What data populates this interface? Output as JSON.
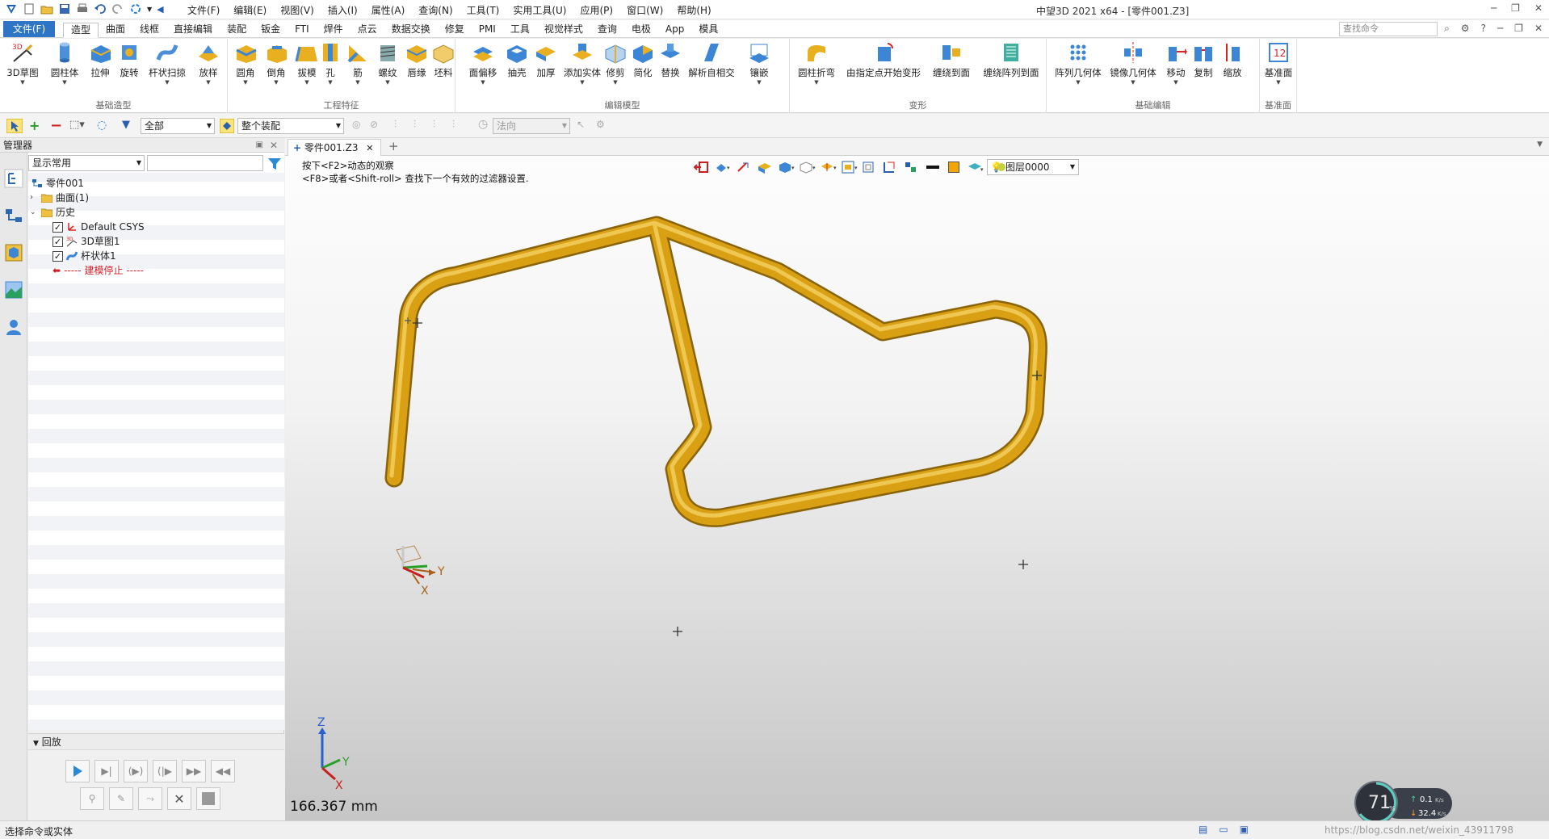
{
  "titlebar": {
    "menus": [
      "文件(F)",
      "编辑(E)",
      "视图(V)",
      "插入(I)",
      "属性(A)",
      "查询(N)",
      "工具(T)",
      "实用工具(U)",
      "应用(P)",
      "窗口(W)",
      "帮助(H)"
    ],
    "window_title": "中望3D 2021 x64 - [零件001.Z3]"
  },
  "tabs": {
    "file": "文件(F)",
    "items": [
      "造型",
      "曲面",
      "线框",
      "直接编辑",
      "装配",
      "钣金",
      "FTI",
      "焊件",
      "点云",
      "数据交换",
      "修复",
      "PMI",
      "工具",
      "视觉样式",
      "查询",
      "电极",
      "App",
      "模具"
    ],
    "active": "造型",
    "search_placeholder": "查找命令"
  },
  "ribbon": {
    "groups": [
      {
        "title": "基础造型",
        "buttons": [
          "3D草图",
          "圆柱体",
          "拉伸",
          "旋转",
          "杆状扫掠",
          "放样"
        ]
      },
      {
        "title": "工程特征",
        "buttons": [
          "圆角",
          "倒角",
          "拔模",
          "孔",
          "筋",
          "螺纹",
          "唇缘",
          "坯料"
        ]
      },
      {
        "title": "编辑模型",
        "buttons": [
          "面偏移",
          "抽壳",
          "加厚",
          "添加实体",
          "修剪",
          "简化",
          "替换",
          "解析自相交",
          "镶嵌"
        ]
      },
      {
        "title": "变形",
        "buttons": [
          "圆柱折弯",
          "由指定点开始变形",
          "缠绕到面",
          "缠绕阵列到面"
        ]
      },
      {
        "title": "基础编辑",
        "buttons": [
          "阵列几何体",
          "镜像几何体",
          "移动",
          "复制",
          "缩放"
        ]
      },
      {
        "title": "基准面",
        "buttons": [
          "基准面"
        ]
      }
    ]
  },
  "toolbar2": {
    "filter": "全部",
    "scope": "整个装配",
    "direction": "法向"
  },
  "manager": {
    "title": "管理器",
    "display_filter": "显示常用",
    "tree": [
      {
        "label": "零件001",
        "level": 0,
        "checkbox": false
      },
      {
        "label": "曲面(1)",
        "level": 1,
        "checkbox": false
      },
      {
        "label": "历史",
        "level": 1,
        "checkbox": false
      },
      {
        "label": "Default CSYS",
        "level": 2,
        "checkbox": true
      },
      {
        "label": "3D草图1",
        "level": 2,
        "checkbox": true
      },
      {
        "label": "杆状体1",
        "level": 2,
        "checkbox": true
      },
      {
        "label": "----- 建模停止 -----",
        "level": 2,
        "checkbox": false
      }
    ]
  },
  "playback": {
    "title": "回放"
  },
  "viewport": {
    "doc_tab": "零件001.Z3",
    "hint_line1": "按下<F2>动态的观察",
    "hint_line2": "<F8>或者<Shift-roll> 查找下一个有效的过滤器设置.",
    "layer": "图层0000",
    "measure": "166.367 mm",
    "axis_labels": {
      "x": "X",
      "y": "Y",
      "z": "Z"
    },
    "model_color": "#d8a012"
  },
  "netmon": {
    "percent": "71",
    "percent_unit": "%",
    "up": "0.1",
    "down": "32.4",
    "rate_unit": "K/s"
  },
  "status": {
    "text": "选择命令或实体",
    "url": "https://blog.csdn.net/weixin_43911798"
  }
}
